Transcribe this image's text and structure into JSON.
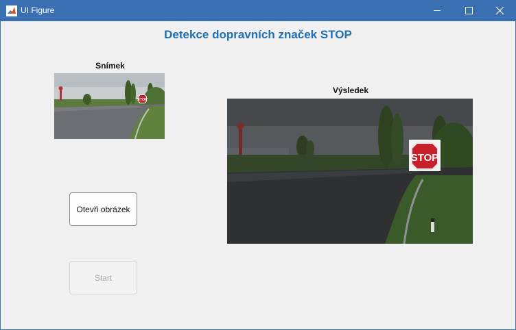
{
  "window": {
    "title": "UI Figure",
    "app_icon": "matlab-icon",
    "controls": {
      "minimize": "minimize-icon",
      "maximize": "maximize-icon",
      "close": "close-icon"
    }
  },
  "heading": "Detekce dopravních značek STOP",
  "input_panel": {
    "label": "Snímek"
  },
  "result_panel": {
    "label": "Výsledek"
  },
  "buttons": {
    "open_label": "Otevři obrázek",
    "start_label": "Start",
    "start_enabled": false
  },
  "images": {
    "sign_text": "STOP"
  },
  "colors": {
    "heading": "#2070b3",
    "titlebar": "#3a70b2",
    "background": "#f0f0f0"
  }
}
